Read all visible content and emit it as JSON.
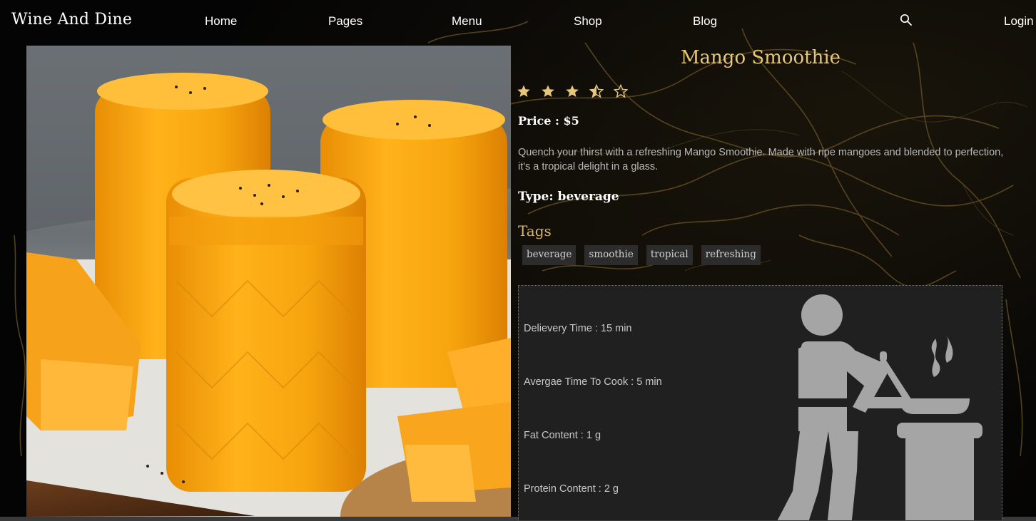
{
  "navbar": {
    "brand": "Wine And Dine",
    "links": [
      "Home",
      "Pages",
      "Menu",
      "Shop",
      "Blog"
    ],
    "login": "Login"
  },
  "product": {
    "title": "Mango Smoothie",
    "rating": 3.5,
    "rating_max": 5,
    "price": "Price : $5",
    "description": "Quench your thirst with a refreshing Mango Smoothie. Made with ripe mangoes and blended to perfection, it's a tropical delight in a glass.",
    "type": "Type: beverage",
    "tags_heading": "Tags",
    "tags": [
      "beverage",
      "smoothie",
      "tropical",
      "refreshing"
    ]
  },
  "info": {
    "delivery": "Delievery Time : 15 min",
    "cook_time": "Avergae Time To Cook : 5 min",
    "fat": "Fat Content : 1 g",
    "protein": "Protein Content : 2 g"
  },
  "colors": {
    "accent_gold": "#e6c77a",
    "tags_heading": "#d6b46a",
    "card_bg": "#202020",
    "icon_grey": "#a5a5a5"
  },
  "icons": {
    "search": "search-icon",
    "star": "star-icon",
    "chef": "chef-cooking-icon"
  }
}
